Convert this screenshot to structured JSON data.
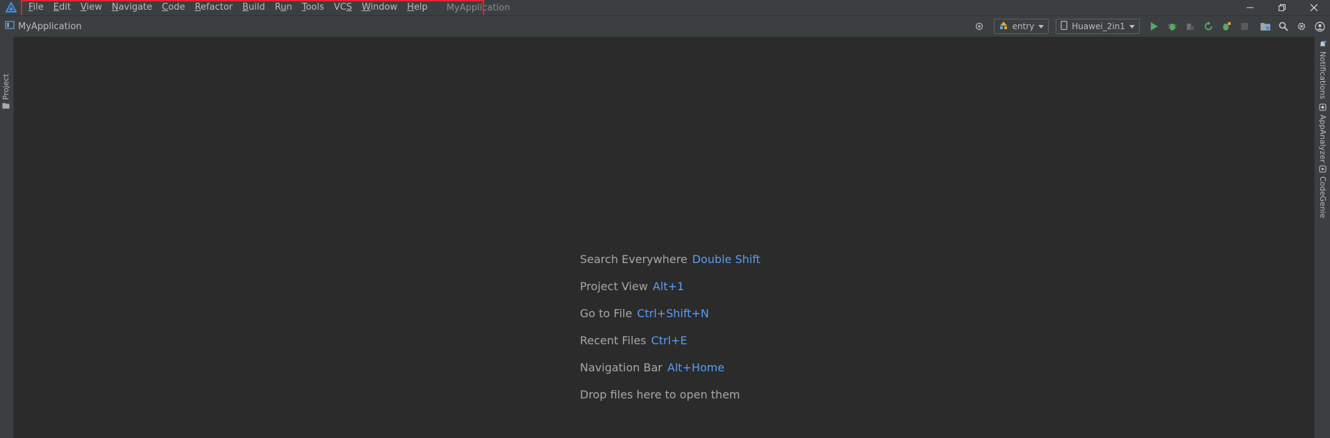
{
  "window": {
    "title": "MyApplication",
    "controls": {
      "minimize": "minimize-icon",
      "restore": "restore-icon",
      "close": "close-icon"
    }
  },
  "menu": [
    {
      "label": "File",
      "mnemonic_index": 0
    },
    {
      "label": "Edit",
      "mnemonic_index": 0
    },
    {
      "label": "View",
      "mnemonic_index": 0
    },
    {
      "label": "Navigate",
      "mnemonic_index": 0
    },
    {
      "label": "Code",
      "mnemonic_index": 0
    },
    {
      "label": "Refactor",
      "mnemonic_index": 0
    },
    {
      "label": "Build",
      "mnemonic_index": 0
    },
    {
      "label": "Run",
      "mnemonic_index": 1
    },
    {
      "label": "Tools",
      "mnemonic_index": 0
    },
    {
      "label": "VCS",
      "mnemonic_index": 2
    },
    {
      "label": "Window",
      "mnemonic_index": 0
    },
    {
      "label": "Help",
      "mnemonic_index": 0
    }
  ],
  "navbar": {
    "breadcrumb": "MyApplication",
    "module_selector": "entry",
    "device_selector": "Huawei_2in1"
  },
  "left_tool_windows": [
    {
      "label": "Project",
      "icon": "folder-icon"
    }
  ],
  "right_tool_windows": [
    {
      "label": "Notifications",
      "icon": "bell-icon"
    },
    {
      "label": "AppAnalyzer",
      "icon": "analyzer-icon"
    },
    {
      "label": "CodeGenie",
      "icon": "codegenie-icon"
    }
  ],
  "editor_hints": [
    {
      "label": "Search Everywhere",
      "key": "Double Shift"
    },
    {
      "label": "Project View",
      "key": "Alt+1"
    },
    {
      "label": "Go to File",
      "key": "Ctrl+Shift+N"
    },
    {
      "label": "Recent Files",
      "key": "Ctrl+E"
    },
    {
      "label": "Navigation Bar",
      "key": "Alt+Home"
    },
    {
      "label": "Drop files here to open them",
      "key": ""
    }
  ],
  "colors": {
    "accent_link": "#589df6",
    "highlight_box": "#e0262d",
    "run_green": "#59a869",
    "panel_bg": "#3c3f41",
    "editor_bg": "#2b2b2b"
  }
}
